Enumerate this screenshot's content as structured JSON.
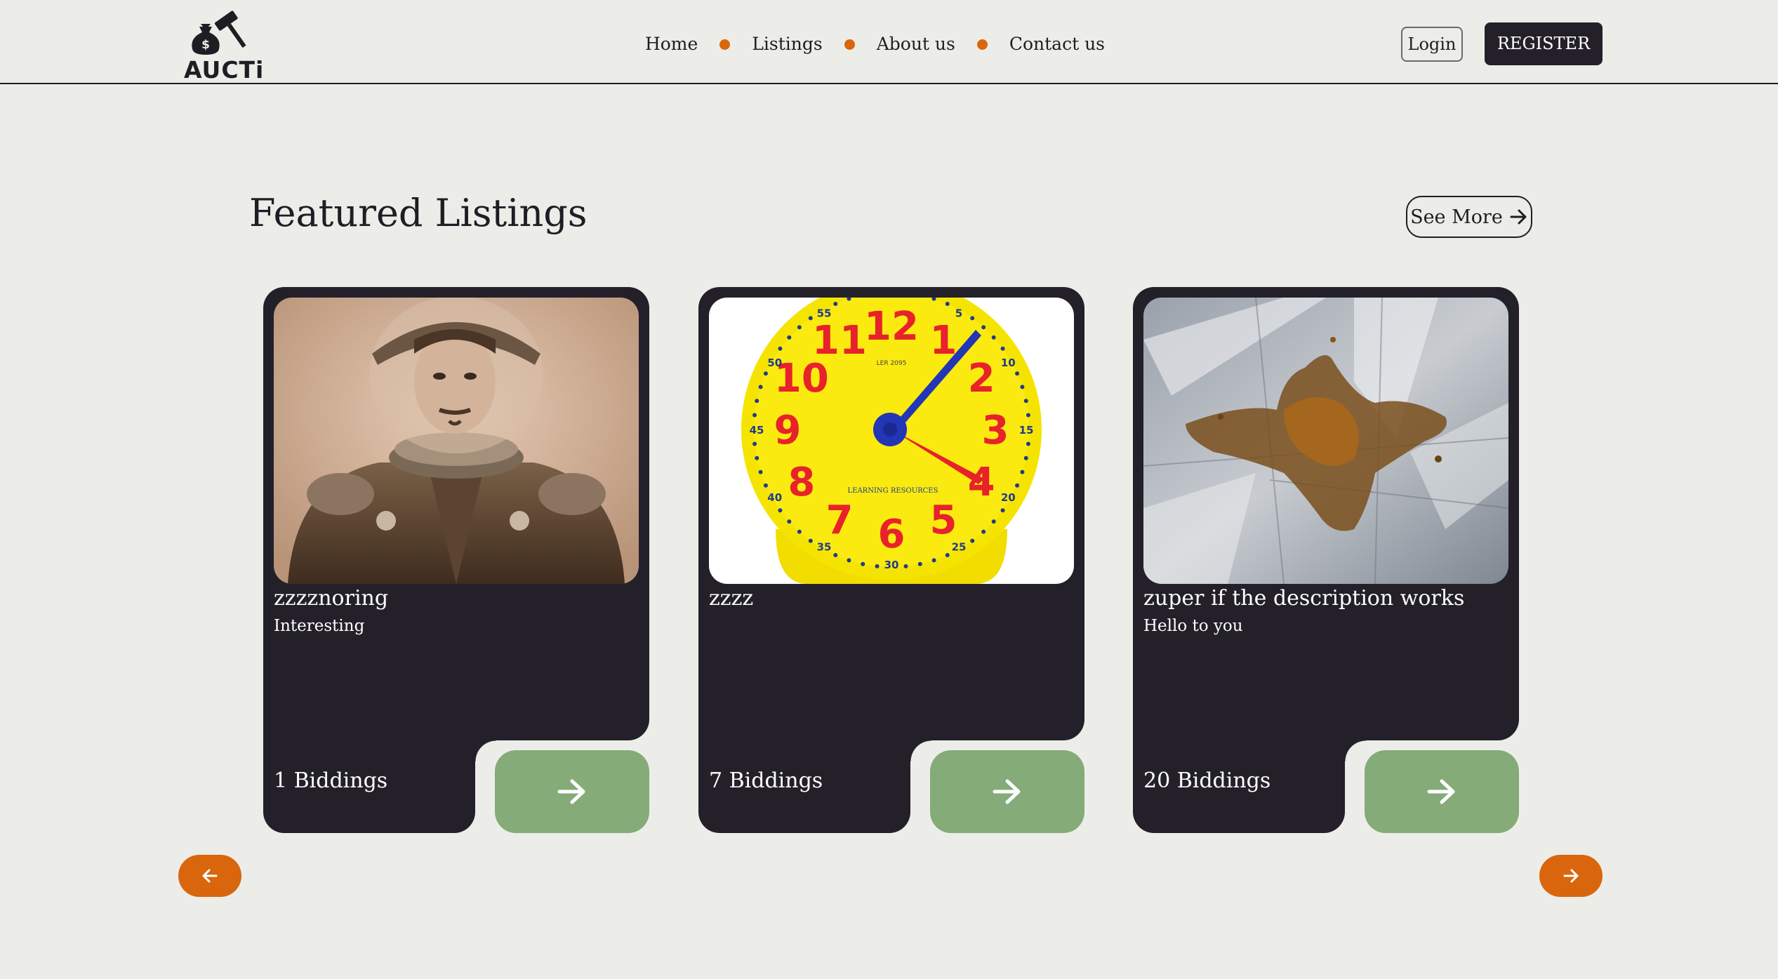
{
  "brand": {
    "name": "AUCTi"
  },
  "nav": {
    "items": [
      {
        "label": "Home"
      },
      {
        "label": "Listings"
      },
      {
        "label": "About us"
      },
      {
        "label": "Contact us"
      }
    ]
  },
  "auth": {
    "login_label": "Login",
    "register_label": "REGISTER"
  },
  "featured": {
    "title": "Featured Listings",
    "see_more_label": "See More",
    "cards": [
      {
        "title": "zzzznoring",
        "description": "Interesting",
        "bids": "1 Biddings",
        "image": "astronaut-portrait"
      },
      {
        "title": "zzzz",
        "description": "",
        "bids": "7 Biddings",
        "image": "yellow-clock"
      },
      {
        "title": "zuper if the description works",
        "description": "Hello to you",
        "bids": "20 Biddings",
        "image": "stain-on-marble"
      }
    ]
  },
  "clock_numbers": [
    "12",
    "1",
    "2",
    "3",
    "4",
    "5",
    "6",
    "7",
    "8",
    "9",
    "10",
    "11"
  ],
  "clock_minutes": [
    "5",
    "10",
    "15",
    "20",
    "25",
    "30",
    "35",
    "40",
    "45",
    "50",
    "55"
  ],
  "clock_model": "LER 2095",
  "clock_brand": "LEARNING RESOURCES",
  "colors": {
    "background": "#ecede8",
    "dark": "#23202a",
    "accent": "#d9660c",
    "go_button": "#84ab78"
  },
  "icons": [
    "gavel-moneybag-icon",
    "arrow-right-icon",
    "arrow-left-icon"
  ]
}
